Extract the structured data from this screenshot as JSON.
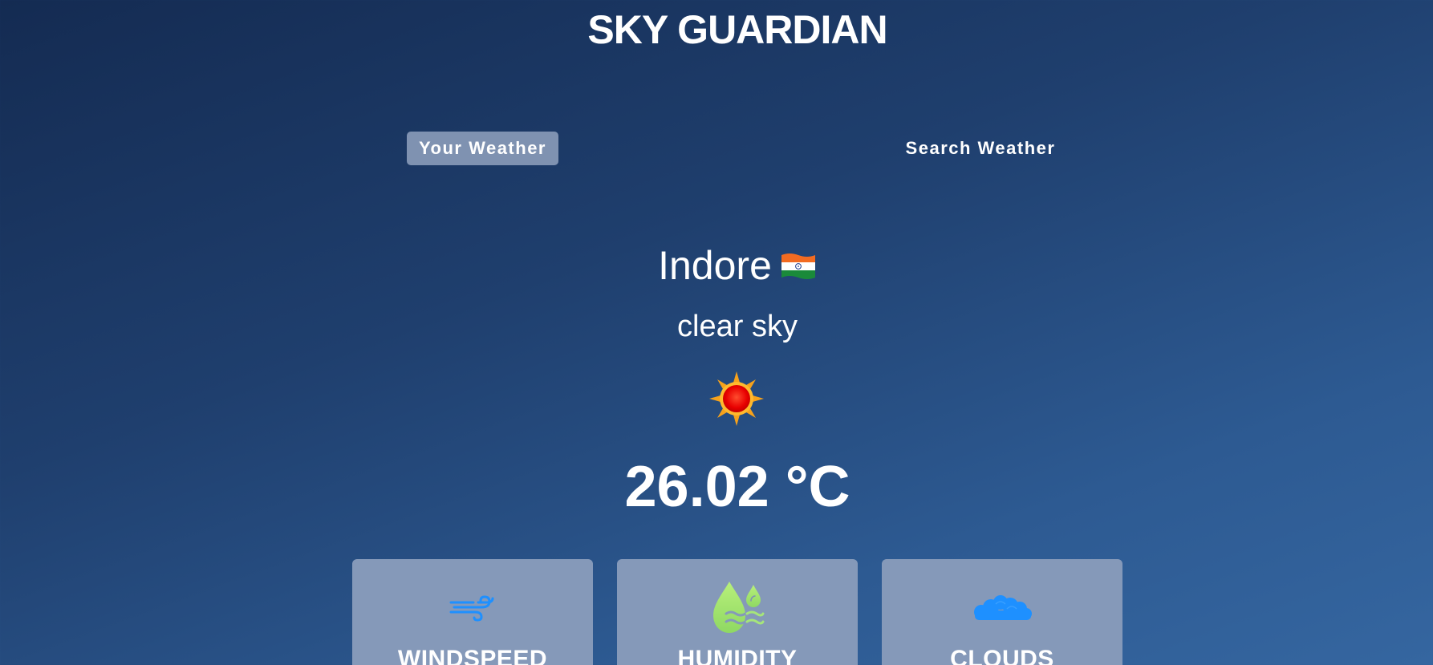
{
  "app": {
    "title": "SKY GUARDIAN"
  },
  "tabs": [
    {
      "label": "Your Weather",
      "active": true
    },
    {
      "label": "Search Weather",
      "active": false
    }
  ],
  "weather": {
    "city": "Indore",
    "country_flag": "india-flag-icon",
    "description": "clear sky",
    "condition_icon": "sun-icon",
    "temperature": "26.02 °C"
  },
  "cards": [
    {
      "label": "WINDSPEED",
      "icon": "wind-icon"
    },
    {
      "label": "HUMIDITY",
      "icon": "humidity-icon"
    },
    {
      "label": "CLOUDS",
      "icon": "cloud-icon"
    }
  ],
  "colors": {
    "background_top": "#142b52",
    "background_bottom": "#3566a0",
    "active_tab": "#7f92b1",
    "card": "#8599b9",
    "wind_icon": "#1e90ff",
    "humidity_icon": "#a6e57a",
    "clouds_icon": "#1e90ff"
  }
}
